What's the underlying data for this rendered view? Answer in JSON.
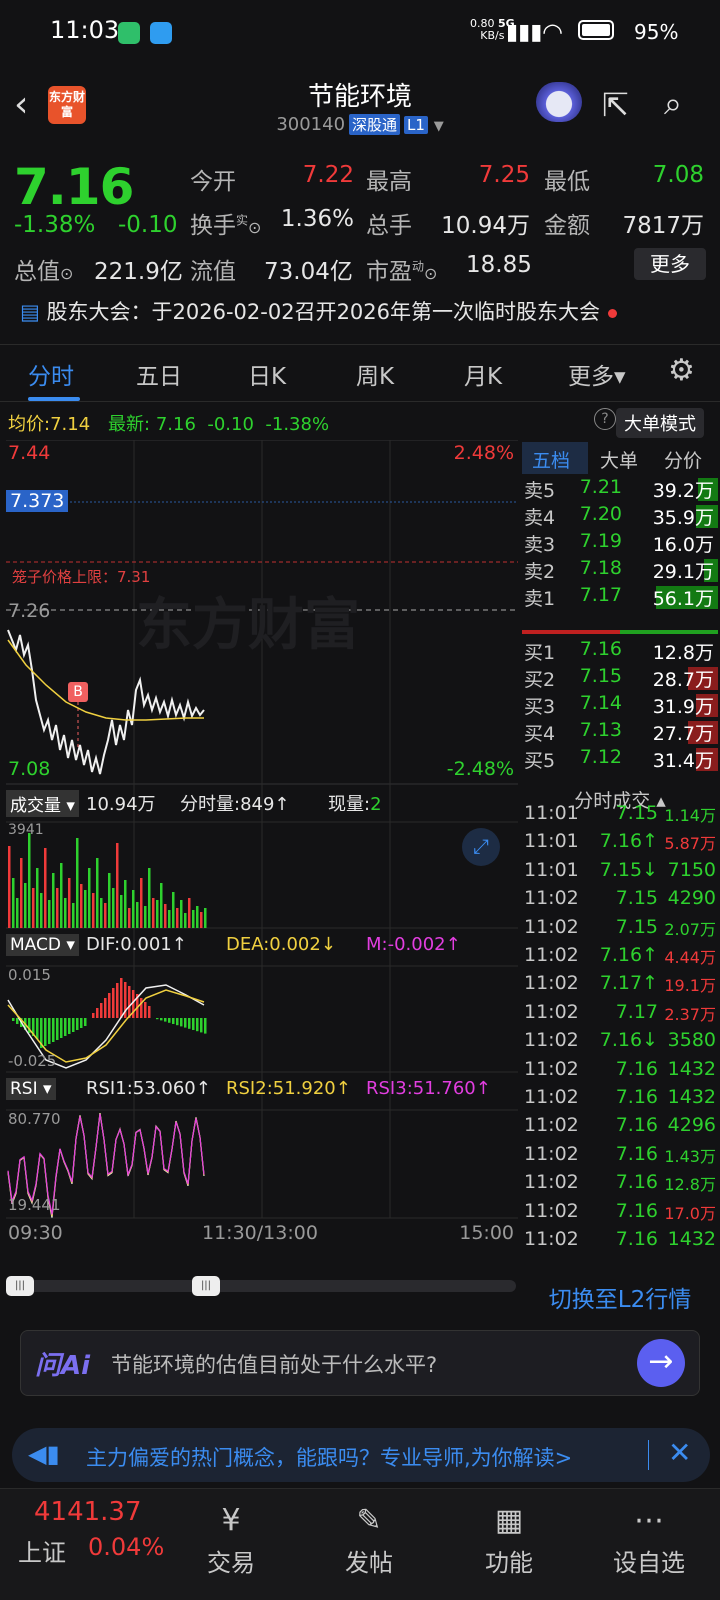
{
  "status_bar": {
    "time": "11:03",
    "net_speed": "0.80",
    "net_unit": "KB/s",
    "net_type": "5G",
    "battery": "95%"
  },
  "header": {
    "back": "‹",
    "logo": "东方财富",
    "title": "节能环境",
    "code": "300140",
    "tag1": "深股通",
    "tag2": "L1",
    "share": "⇱",
    "search": "⌕"
  },
  "quote": {
    "price": "7.16",
    "change_pct": "-1.38%",
    "change": "-0.10",
    "open_label": "今开",
    "open": "7.22",
    "high_label": "最高",
    "high": "7.25",
    "low_label": "最低",
    "low": "7.08",
    "turnover_label": "换手",
    "turnover_sup": "实",
    "turnover": "1.36%",
    "volume_label": "总手",
    "volume": "10.94万",
    "amount_label": "金额",
    "amount": "7817万",
    "mcap_label": "总值",
    "mcap": "221.9亿",
    "float_label": "流值",
    "float": "73.04亿",
    "pe_label": "市盈",
    "pe_sup": "动",
    "pe": "18.85",
    "more": "更多"
  },
  "notice": {
    "text": "股东大会：于2026-02-02召开2026年第一次临时股东大会"
  },
  "tabs": [
    {
      "label": "分时"
    },
    {
      "label": "五日"
    },
    {
      "label": "日K"
    },
    {
      "label": "周K"
    },
    {
      "label": "月K"
    },
    {
      "label": "更多▾"
    }
  ],
  "settings_icon": "⚙",
  "chart_info": {
    "avg_label": "均价:",
    "avg": "7.14",
    "latest_label": "最新:",
    "latest": "7.16",
    "chg": "-0.10",
    "pct": "-1.38%",
    "help": "?",
    "mode": "大单模式"
  },
  "chart_labels": {
    "top_price": "7.44",
    "top_pct": "2.48%",
    "cursor": "7.373",
    "limit": "笼子价格上限：7.31",
    "base": "7.26",
    "bottom_price": "7.08",
    "bottom_pct": "-2.48%",
    "marker": "B",
    "watermark": "东方财富",
    "vol_sel": "成交量 ▾",
    "vol_total": "10.94万",
    "vol_period": "分时量:849↑",
    "vol_now_label": "现量:",
    "vol_now": "2",
    "vol_max": "3941",
    "macd_sel": "MACD ▾",
    "dif": "DIF:0.001↑",
    "dea": "DEA:0.002↓",
    "m": "M:-0.002↑",
    "macd_top": "0.015",
    "macd_bottom": "-0.025",
    "rsi_sel": "RSI ▾",
    "rsi1": "RSI1:53.060↑",
    "rsi2": "RSI2:51.920↑",
    "rsi3": "RSI3:51.760↑",
    "rsi_top": "80.770",
    "rsi_bottom": "19.441",
    "t_start": "09:30",
    "t_mid": "11:30/13:00",
    "t_end": "15:00"
  },
  "book": {
    "tabs": [
      "五档",
      "大单",
      "分价"
    ],
    "asks": [
      {
        "name": "卖5",
        "price": "7.21",
        "vol": "39.2万"
      },
      {
        "name": "卖4",
        "price": "7.20",
        "vol": "35.9万"
      },
      {
        "name": "卖3",
        "price": "7.19",
        "vol": "16.0万"
      },
      {
        "name": "卖2",
        "price": "7.18",
        "vol": "29.1万"
      },
      {
        "name": "卖1",
        "price": "7.17",
        "vol": "56.1万"
      }
    ],
    "bids": [
      {
        "name": "买1",
        "price": "7.16",
        "vol": "12.8万"
      },
      {
        "name": "买2",
        "price": "7.15",
        "vol": "28.7万"
      },
      {
        "name": "买3",
        "price": "7.14",
        "vol": "31.9万"
      },
      {
        "name": "买4",
        "price": "7.13",
        "vol": "27.7万"
      },
      {
        "name": "买5",
        "price": "7.12",
        "vol": "31.4万"
      }
    ],
    "ticks_title": "分时成交 ▴",
    "ticks": [
      {
        "t": "11:01",
        "p": "7.15",
        "v": "1.14万"
      },
      {
        "t": "11:01",
        "p": "7.16↑",
        "v": "5.87万"
      },
      {
        "t": "11:01",
        "p": "7.15↓",
        "v": "7150"
      },
      {
        "t": "11:02",
        "p": "7.15",
        "v": "4290"
      },
      {
        "t": "11:02",
        "p": "7.15",
        "v": "2.07万"
      },
      {
        "t": "11:02",
        "p": "7.16↑",
        "v": "4.44万"
      },
      {
        "t": "11:02",
        "p": "7.17↑",
        "v": "19.1万"
      },
      {
        "t": "11:02",
        "p": "7.17",
        "v": "2.37万"
      },
      {
        "t": "11:02",
        "p": "7.16↓",
        "v": "3580"
      },
      {
        "t": "11:02",
        "p": "7.16",
        "v": "1432"
      },
      {
        "t": "11:02",
        "p": "7.16",
        "v": "1432"
      },
      {
        "t": "11:02",
        "p": "7.16",
        "v": "4296"
      },
      {
        "t": "11:02",
        "p": "7.16",
        "v": "1.43万"
      },
      {
        "t": "11:02",
        "p": "7.16",
        "v": "12.8万"
      },
      {
        "t": "11:02",
        "p": "7.16",
        "v": "17.0万"
      },
      {
        "t": "11:02",
        "p": "7.16",
        "v": "1432"
      }
    ]
  },
  "l2_switch": "切换至L2行情",
  "ai": {
    "logo": "问Ai",
    "question": "节能环境的估值目前处于什么水平?",
    "go": "→"
  },
  "promo": {
    "text": "主力偏爱的热门概念，能跟吗？专业导师,为你解读>",
    "close": "✕"
  },
  "nav": {
    "index_value": "4141.37",
    "index_name": "上证",
    "index_pct": "0.04%",
    "items": [
      {
        "icon": "¥",
        "label": "交易"
      },
      {
        "icon": "✎",
        "label": "发帖"
      },
      {
        "icon": "▦",
        "label": "功能"
      },
      {
        "icon": "⋯",
        "label": "设自选"
      }
    ]
  },
  "colors": {
    "up": "#f03a3a",
    "down": "#2ed12e",
    "accent": "#3b8cf0",
    "avg": "#f0d040"
  }
}
